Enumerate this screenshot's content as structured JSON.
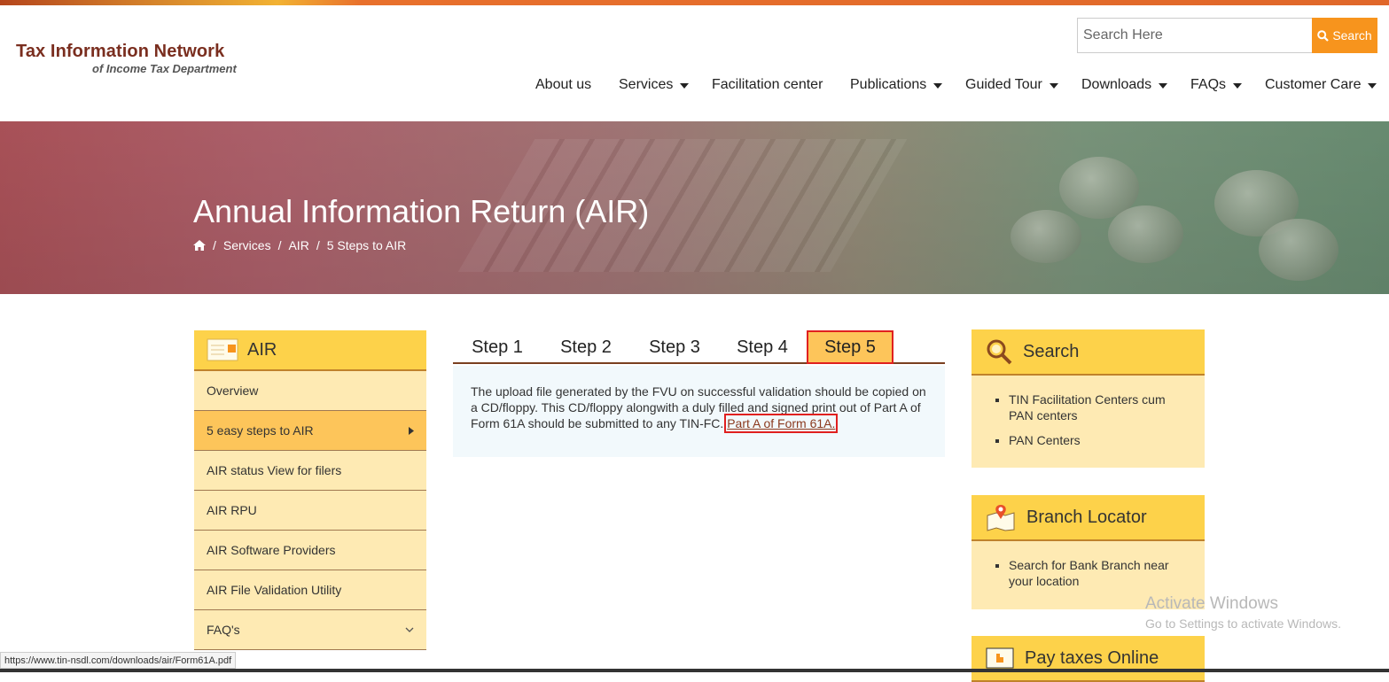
{
  "header": {
    "logo_title": "Tax Information Network",
    "logo_subtitle": "of Income Tax Department",
    "search_placeholder": "Search Here",
    "search_button": "Search",
    "nav": [
      {
        "label": "About us"
      },
      {
        "label": "Services"
      },
      {
        "label": "Facilitation center"
      },
      {
        "label": "Publications"
      },
      {
        "label": "Guided Tour"
      },
      {
        "label": "Downloads"
      },
      {
        "label": "FAQs"
      },
      {
        "label": "Customer Care"
      }
    ]
  },
  "banner": {
    "title": "Annual Information Return (AIR)",
    "breadcrumb": [
      "Services",
      "AIR",
      "5 Steps to AIR"
    ],
    "separator": "/"
  },
  "sidebar": {
    "title": "AIR",
    "items": [
      {
        "label": "Overview"
      },
      {
        "label": "5 easy steps to AIR"
      },
      {
        "label": "AIR status View for filers"
      },
      {
        "label": "AIR RPU"
      },
      {
        "label": "AIR Software Providers"
      },
      {
        "label": "AIR File Validation Utility"
      },
      {
        "label": "FAQ's"
      }
    ]
  },
  "steps": {
    "tabs": [
      "Step 1",
      "Step 2",
      "Step 3",
      "Step 4",
      "Step 5"
    ],
    "active": "Step 5",
    "content": "The upload file generated by the FVU on successful validation should be copied on a CD/floppy. This CD/floppy alongwith a duly filled and signed print out of Part A of Form 61A should be submitted to any TIN-FC.",
    "link": "Part A of Form 61A."
  },
  "right_cards": {
    "search": {
      "title": "Search",
      "items": [
        "TIN Facilitation Centers cum PAN centers",
        "PAN Centers"
      ]
    },
    "branch": {
      "title": "Branch Locator",
      "items": [
        "Search for Bank Branch near  your location"
      ]
    },
    "pay": {
      "title": "Pay taxes Online"
    }
  },
  "watermark": {
    "line1": "Activate Windows",
    "line2": "Go to Settings to activate Windows."
  },
  "status_url": "https://www.tin-nsdl.com/downloads/air/Form61A.pdf",
  "colors": {
    "brand_text": "#7a2e1f",
    "accent_orange": "#f7941d",
    "card_yellow": "#fdd24a",
    "card_bg": "#feeab3",
    "active_item": "#fdc55a",
    "highlight_red": "#e0201f"
  }
}
